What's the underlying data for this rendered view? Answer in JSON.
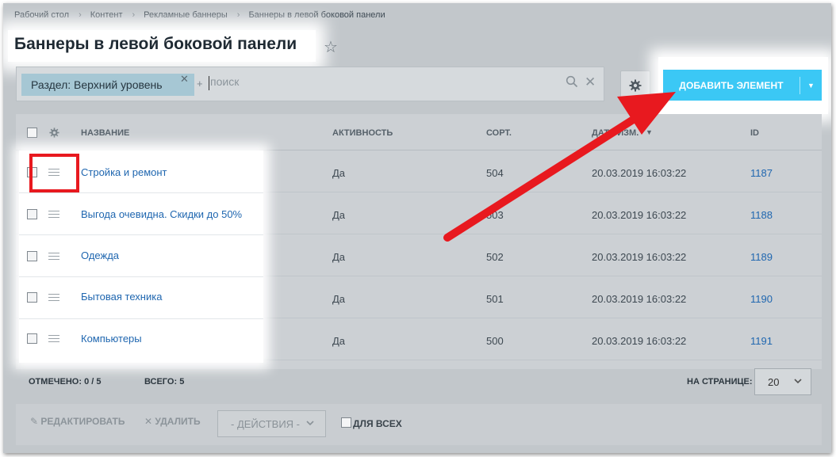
{
  "breadcrumb": [
    "Рабочий стол",
    "Контент",
    "Рекламные баннеры",
    "Баннеры в левой боковой панели"
  ],
  "page_title": "Баннеры в левой боковой панели",
  "filter": {
    "chip_label": "Раздел: Верхний уровень",
    "search_placeholder": "поиск"
  },
  "add_button_label": "ДОБАВИТЬ ЭЛЕМЕНТ",
  "table": {
    "headers": {
      "name": "НАЗВАНИЕ",
      "active": "АКТИВНОСТЬ",
      "sort": "СОРТ.",
      "date": "ДАТА ИЗМ.",
      "id": "ID"
    },
    "rows": [
      {
        "name": "Стройка и ремонт",
        "active": "Да",
        "sort": "504",
        "date": "20.03.2019 16:03:22",
        "id": "1187"
      },
      {
        "name": "Выгода очевидна. Скидки до 50%",
        "active": "Да",
        "sort": "503",
        "date": "20.03.2019 16:03:22",
        "id": "1188"
      },
      {
        "name": "Одежда",
        "active": "Да",
        "sort": "502",
        "date": "20.03.2019 16:03:22",
        "id": "1189"
      },
      {
        "name": "Бытовая техника",
        "active": "Да",
        "sort": "501",
        "date": "20.03.2019 16:03:22",
        "id": "1190"
      },
      {
        "name": "Компьютеры",
        "active": "Да",
        "sort": "500",
        "date": "20.03.2019 16:03:22",
        "id": "1191"
      }
    ]
  },
  "footer": {
    "selected_label": "ОТМЕЧЕНО:",
    "selected_value": "0 / 5",
    "total_label": "ВСЕГО:",
    "total_value": "5",
    "per_page_label": "НА СТРАНИЦЕ:",
    "per_page_value": "20"
  },
  "bottom_bar": {
    "edit_label": "РЕДАКТИРОВАТЬ",
    "delete_label": "УДАЛИТЬ",
    "actions_placeholder": "- ДЕЙСТВИЯ -",
    "for_all_label": "ДЛЯ ВСЕХ"
  },
  "colors": {
    "accent_button": "#3bc8f5",
    "link": "#2067b0",
    "highlight_red": "#e8191f",
    "overlay_gray": "#c2c7cb"
  },
  "icons": [
    "star-icon",
    "search-icon",
    "close-icon",
    "gear-icon",
    "chevron-down-icon",
    "drag-handle-icon",
    "pencil-icon",
    "delete-x-icon"
  ]
}
